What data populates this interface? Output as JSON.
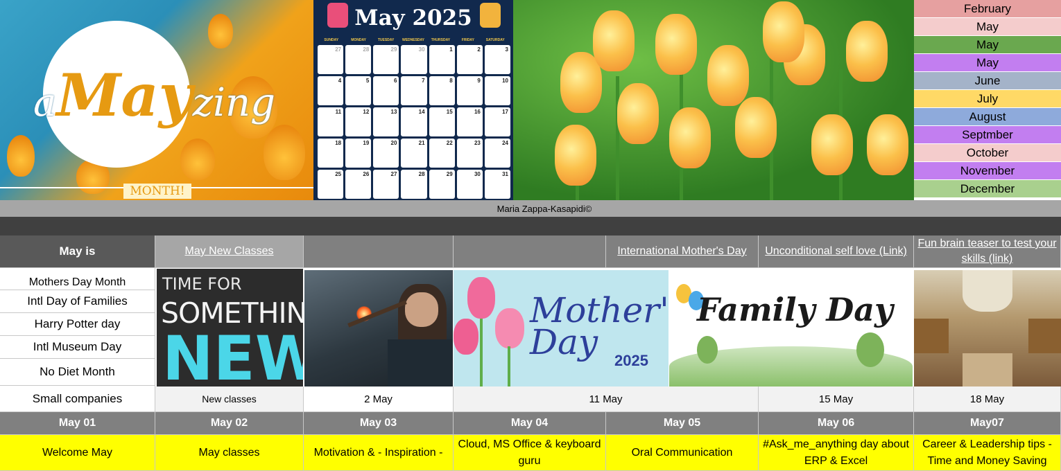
{
  "banner": {
    "amay_pre": "a",
    "amay_may": "May",
    "amay_post": "zing",
    "month_badge": "MONTH!",
    "calendar_title": "May 2025",
    "calendar_weekdays": [
      "SUNDAY",
      "MONDAY",
      "TUESDAY",
      "WEDNESDAY",
      "THURSDAY",
      "FRIDAY",
      "SATURDAY"
    ],
    "calendar_days": [
      "27",
      "28",
      "29",
      "30",
      "1",
      "2",
      "3",
      "4",
      "5",
      "6",
      "7",
      "8",
      "9",
      "10",
      "11",
      "12",
      "13",
      "14",
      "15",
      "16",
      "17",
      "18",
      "19",
      "20",
      "21",
      "22",
      "23",
      "24",
      "25",
      "26",
      "27",
      "28",
      "29",
      "30",
      "31"
    ]
  },
  "month_list": [
    {
      "label": "February",
      "color": "#e6a0a0"
    },
    {
      "label": "May",
      "color": "#f4cccc"
    },
    {
      "label": "May",
      "color": "#6aa84f"
    },
    {
      "label": "May",
      "color": "#c27ef0"
    },
    {
      "label": "June",
      "color": "#a4b3c9"
    },
    {
      "label": "July",
      "color": "#ffd966"
    },
    {
      "label": "August",
      "color": "#8eaadb"
    },
    {
      "label": "Septmber",
      "color": "#c27ef0"
    },
    {
      "label": "October",
      "color": "#f4cccc"
    },
    {
      "label": "November",
      "color": "#c27ef0"
    },
    {
      "label": "December",
      "color": "#a9d08e"
    }
  ],
  "credit": "Maria Zappa-Kasapidi©",
  "table": {
    "side_header": "May is",
    "side_items": [
      "Mothers Day Month",
      "Intl Day of Families",
      "Harry Potter day",
      "Intl Museum Day",
      "No Diet Month",
      "Small companies"
    ],
    "links": {
      "new_classes": "May New Classes",
      "mothers_day": "International Mother's Day",
      "self_love": "Unconditional self love (Link)",
      "brain_teaser": "Fun brain teaser to test your skills (link)"
    },
    "images": {
      "new_l1": "TIME FOR",
      "new_l2": "SOMETHING",
      "new_l3": "NEW!",
      "mom_text": "Mother's Day",
      "mom_year": "2025",
      "family_text": "Family Day"
    },
    "dates": [
      "New classes",
      "2 May",
      "11 May",
      "15 May",
      "18 May"
    ],
    "days": [
      "May 01",
      "May 02",
      "May 03",
      "May 04",
      "May 05",
      "May 06",
      "May07"
    ],
    "topics": [
      "Welcome May",
      "May classes",
      "Motivation & - Inspiration -",
      "Cloud, MS Office & keyboard guru",
      "Oral Communication",
      "#Ask_me_anything day about ERP & Excel",
      "Career & Leadership tips - Time and Money Saving"
    ]
  }
}
